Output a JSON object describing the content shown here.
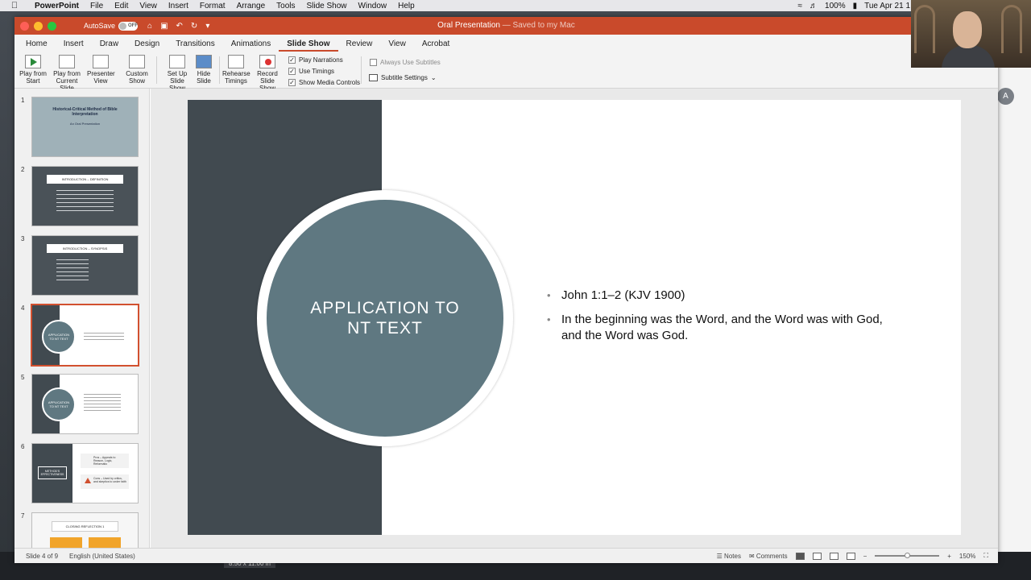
{
  "menubar": {
    "app": "PowerPoint",
    "items": [
      "File",
      "Edit",
      "View",
      "Insert",
      "Format",
      "Arrange",
      "Tools",
      "Slide Show",
      "Window",
      "Help"
    ],
    "battery": "100%",
    "clock": "Tue Apr 21 1"
  },
  "window": {
    "autosave_label": "AutoSave",
    "autosave_state": "OFF",
    "doc_name": "Oral Presentation",
    "doc_status": "— Saved to my Mac"
  },
  "tabs": [
    "Home",
    "Insert",
    "Draw",
    "Design",
    "Transitions",
    "Animations",
    "Slide Show",
    "Review",
    "View",
    "Acrobat"
  ],
  "active_tab": "Slide Show",
  "ribbon": {
    "play_start": [
      "Play from",
      "Start"
    ],
    "play_current": [
      "Play from",
      "Current Slide"
    ],
    "presenter": [
      "Presenter",
      "View"
    ],
    "custom": [
      "Custom",
      "Show"
    ],
    "setup": [
      "Set Up",
      "Slide Show"
    ],
    "hide": [
      "Hide",
      "Slide"
    ],
    "rehearse": [
      "Rehearse",
      "Timings"
    ],
    "record": [
      "Record",
      "Slide Show"
    ],
    "play_narrations": "Play Narrations",
    "use_timings": "Use Timings",
    "show_media": "Show Media Controls",
    "always_subtitles": "Always Use Subtitles",
    "subtitle_settings": "Subtitle Settings"
  },
  "thumbnails": {
    "numbers": [
      "1",
      "2",
      "3",
      "4",
      "5",
      "6",
      "7"
    ],
    "s1": {
      "title": "Historical-Critical Method of Bible Interpretation",
      "sub": "An Oral Presentation"
    },
    "s2": {
      "header": "INTRODUCTION – DEFINITION"
    },
    "s3": {
      "header": "INTRODUCTION – SYNOPSIS"
    },
    "s4": {
      "circle": "APPLICATION TO NT TEXT"
    },
    "s5": {
      "circle": "APPLICATION TO NT TEXT"
    },
    "s6": {
      "box": "METHOD'S EFFECTIVENESS",
      "pro": "Pros – Appeals to Reason, Logic, Reformatio",
      "con": "Cons – Used by critics, and skeptics to under faith"
    },
    "s7": {
      "header": "CLOSING REFLECTION 1"
    }
  },
  "slide": {
    "circle_title": "APPLICATION TO NT TEXT",
    "bullet1": "John 1:1–2 (KJV 1900)",
    "bullet2": "In the beginning was the Word, and the Word was with God, and the Word was God."
  },
  "status": {
    "slide_of": "Slide 4 of 9",
    "language": "English (United States)",
    "notes": "Notes",
    "comments": "Comments",
    "zoom": "150%"
  },
  "page_size": "8.50 x 11.00 in",
  "avatar_initial": "A",
  "colors": {
    "title_bar": "#c94a2b",
    "slide_panel": "#414a50",
    "circle_fill": "#5f7881",
    "selection": "#d2502f"
  }
}
